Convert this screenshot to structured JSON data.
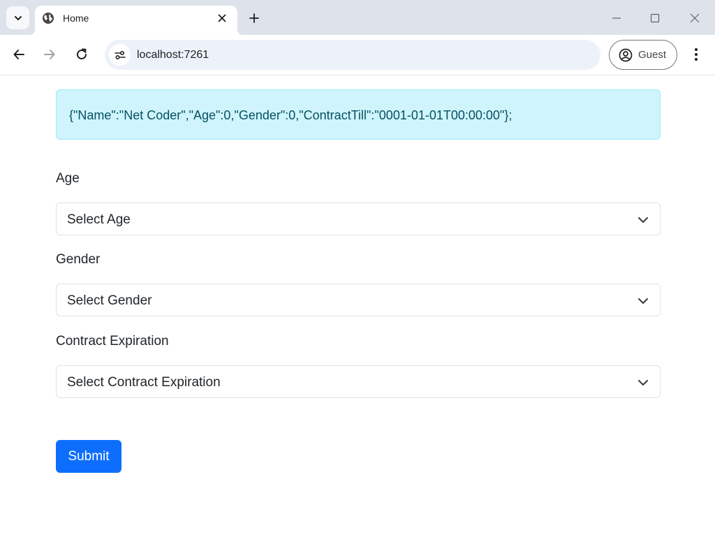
{
  "browser": {
    "tab": {
      "title": "Home"
    },
    "address": {
      "url": "localhost:7261"
    },
    "profile": {
      "label": "Guest"
    }
  },
  "page": {
    "alert_text": "{\"Name\":\"Net Coder\",\"Age\":0,\"Gender\":0,\"ContractTill\":\"0001-01-01T00:00:00\"};",
    "fields": [
      {
        "label": "Age",
        "selected": "Select Age"
      },
      {
        "label": "Gender",
        "selected": "Select Gender"
      },
      {
        "label": "Contract Expiration",
        "selected": "Select Contract Expiration"
      }
    ],
    "submit_label": "Submit"
  },
  "colors": {
    "tabstrip": "#dee3eb",
    "omnibox": "#edf2fa",
    "alert_bg": "#cff4fc",
    "alert_text": "#055160",
    "primary": "#0d6efd"
  },
  "icons": [
    "tab-search-icon",
    "globe-icon",
    "close-icon",
    "plus-icon",
    "minimize-icon",
    "maximize-icon",
    "window-close-icon",
    "back-arrow-icon",
    "forward-arrow-icon",
    "reload-icon",
    "site-settings-icon",
    "profile-icon",
    "more-vert-icon",
    "chevron-down-icon"
  ]
}
